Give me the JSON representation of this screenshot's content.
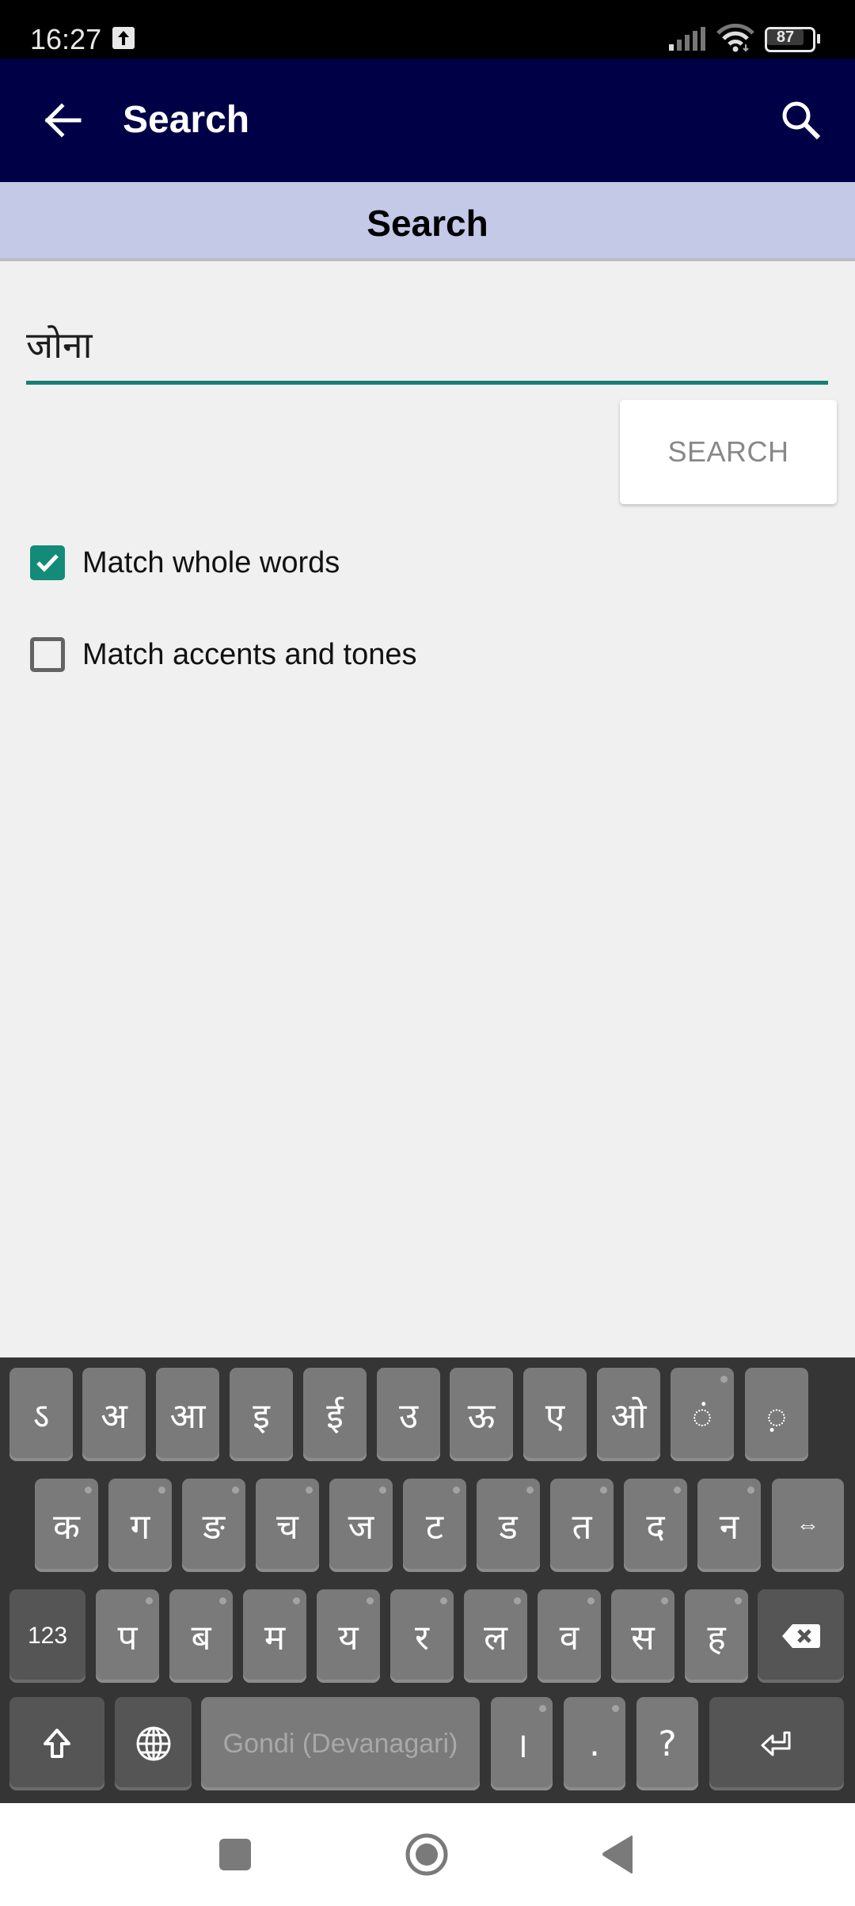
{
  "status_bar": {
    "time": "16:27",
    "upload_icon": "upload-arrow-icon",
    "signal_icon": "cell-signal-icon",
    "wifi_icon": "wifi-icon",
    "battery_level": "87"
  },
  "app_bar": {
    "back_icon": "arrow-left-icon",
    "title": "Search",
    "search_icon": "magnifier-icon"
  },
  "sub_header": {
    "title": "Search"
  },
  "search": {
    "value": "जोना",
    "placeholder": "",
    "button_label": "SEARCH",
    "accent_color": "#178072"
  },
  "options": [
    {
      "label": "Match whole words",
      "checked": true
    },
    {
      "label": "Match accents and tones",
      "checked": false
    }
  ],
  "keyboard": {
    "row1": [
      "ऽ",
      "अ",
      "आ",
      "इ",
      "ई",
      "उ",
      "ऊ",
      "ए",
      "ओ",
      "◌ं",
      "◌़"
    ],
    "row2": [
      "क",
      "ग",
      "ङ",
      "च",
      "ज",
      "ट",
      "ड",
      "त",
      "द",
      "न",
      "⇔"
    ],
    "row3_left": "123",
    "row3": [
      "प",
      "ब",
      "म",
      "य",
      "र",
      "ल",
      "व",
      "स",
      "ह"
    ],
    "row3_right": "backspace-icon",
    "row4": {
      "shift": "shift-arrow-icon",
      "globe": "globe-icon",
      "space_label": "Gondi (Devanagari)",
      "danda": "।",
      "period": ".",
      "question": "?",
      "enter": "enter-icon"
    }
  },
  "nav_bar": {
    "recents": "recents-square-icon",
    "home": "home-circle-icon",
    "back": "back-triangle-icon"
  }
}
